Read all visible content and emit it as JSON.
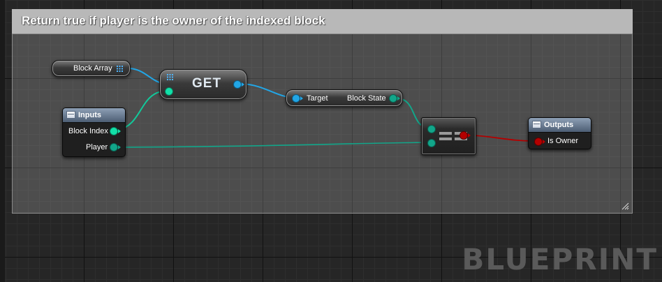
{
  "comment": {
    "title": "Return true if player is the owner of the indexed block"
  },
  "nodes": {
    "block_array": {
      "label": "Block Array"
    },
    "inputs": {
      "title": "Inputs",
      "pins": {
        "block_index": "Block Index",
        "player": "Player"
      }
    },
    "get": {
      "label": "GET"
    },
    "block_state": {
      "target": "Target",
      "output": "Block State"
    },
    "equal": {
      "label": "=="
    },
    "outputs": {
      "title": "Outputs",
      "pins": {
        "is_owner": "Is Owner"
      }
    }
  },
  "watermark": "BLUEPRINT",
  "colors": {
    "graph_bg": "#262626",
    "wire_object": "#12a68a",
    "wire_struct": "#22a6e6",
    "wire_bool": "#b40000",
    "watermark": "#5a5a5a"
  }
}
